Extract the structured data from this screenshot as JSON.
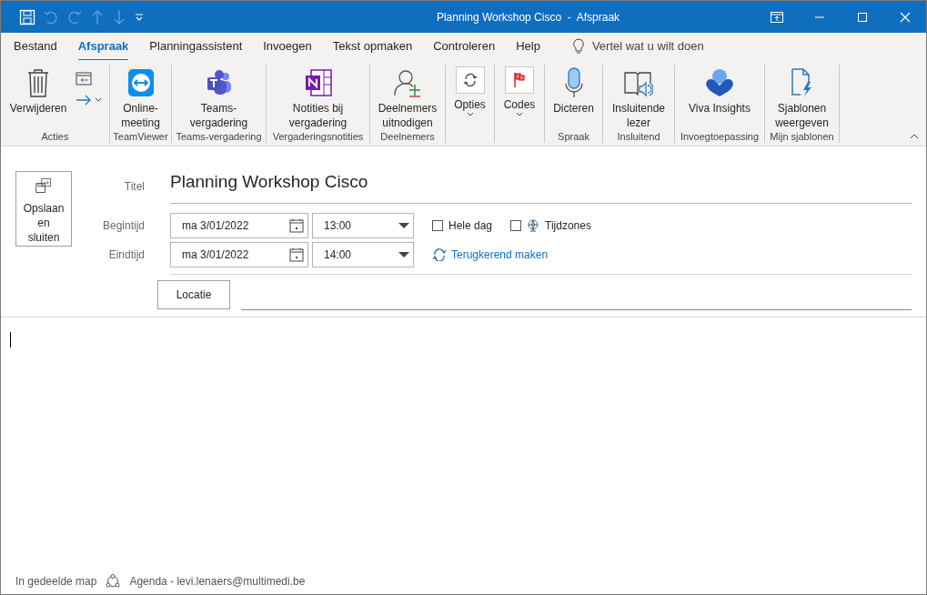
{
  "window": {
    "title": "Planning Workshop Cisco  -  Afspraak"
  },
  "tabs": [
    {
      "label": "Bestand",
      "selected": false
    },
    {
      "label": "Afspraak",
      "selected": true
    },
    {
      "label": "Planningassistent",
      "selected": false
    },
    {
      "label": "Invoegen",
      "selected": false
    },
    {
      "label": "Tekst opmaken",
      "selected": false
    },
    {
      "label": "Controleren",
      "selected": false
    },
    {
      "label": "Help",
      "selected": false
    }
  ],
  "tell_me": {
    "placeholder": "Vertel wat u wilt doen"
  },
  "ribbon_groups": [
    {
      "label": "Acties",
      "buttons": [
        {
          "label": "Verwijderen",
          "kind": "large"
        }
      ]
    },
    {
      "label": "TeamViewer",
      "buttons": [
        {
          "label": "Online-meeting",
          "kind": "large"
        }
      ]
    },
    {
      "label": "Teams-vergadering",
      "buttons": [
        {
          "label": "Teams-vergadering",
          "kind": "large"
        }
      ]
    },
    {
      "label": "Vergaderingsnotities",
      "buttons": [
        {
          "label": "Notities bij vergadering",
          "kind": "large"
        }
      ]
    },
    {
      "label": "Deelnemers",
      "buttons": [
        {
          "label": "Deelnemers uitnodigen",
          "kind": "large"
        }
      ]
    },
    {
      "buttons": [
        {
          "label": "Opties",
          "kind": "dropdown"
        }
      ]
    },
    {
      "buttons": [
        {
          "label": "Codes",
          "kind": "dropdown"
        }
      ]
    },
    {
      "label": "Spraak",
      "buttons": [
        {
          "label": "Dicteren",
          "kind": "large"
        }
      ]
    },
    {
      "label": "Insluitend",
      "buttons": [
        {
          "label": "Insluitende lezer",
          "kind": "large"
        }
      ]
    },
    {
      "label": "Invoegtoepassing",
      "buttons": [
        {
          "label": "Viva Insights",
          "kind": "large"
        }
      ]
    },
    {
      "label": "Mijn sjablonen",
      "buttons": [
        {
          "label": "Sjablonen weergeven",
          "kind": "large"
        }
      ]
    }
  ],
  "form": {
    "save_button": "Opslaan en sluiten",
    "title_label": "Titel",
    "title_value": "Planning Workshop Cisco",
    "start_label": "Begintijd",
    "start_date": "ma 3/01/2022",
    "start_time": "13:00",
    "end_label": "Eindtijd",
    "end_date": "ma 3/01/2022",
    "end_time": "14:00",
    "checkboxes": [
      {
        "label": "Hele dag",
        "checked": false,
        "kind": "plain"
      },
      {
        "label": "Tijdzones",
        "checked": false,
        "kind": "globe"
      }
    ],
    "recurrence_link": "Terugkerend maken",
    "location_button": "Locatie"
  },
  "status_bar": {
    "folder": "In gedeelde map",
    "calendar": "Agenda - levi.lenaers@multimedi.be"
  }
}
